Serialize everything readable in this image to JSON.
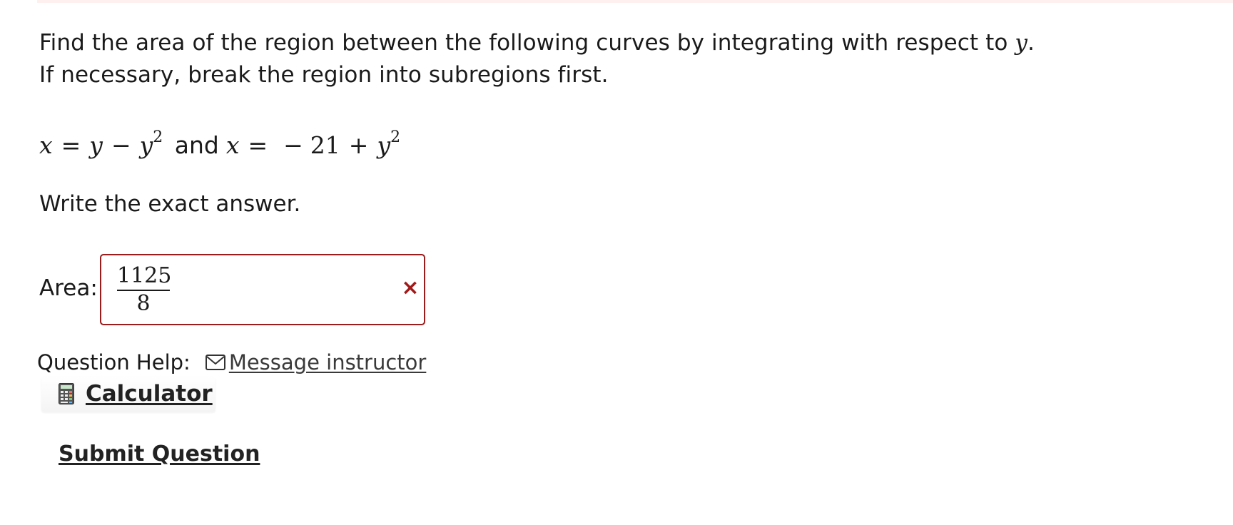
{
  "question": {
    "text_before_var": "Find the area of the region between the following curves by integrating with respect to ",
    "variable": "y",
    "text_after_var": ". If necessary, break the region into subregions first."
  },
  "equation": {
    "lhs1": "x",
    "eq1_y": "y",
    "eq1_minus": "−",
    "eq1_y2": "y",
    "eq1_exp": "2",
    "conjunction": "and",
    "lhs2": "x",
    "eq2_minus": "−",
    "eq2_const": "21",
    "eq2_plus": "+",
    "eq2_y": "y",
    "eq2_exp": "2",
    "equals": "="
  },
  "instruction": "Write the exact answer.",
  "answer": {
    "label": "Area:",
    "numerator": "1125",
    "denominator": "8",
    "status": "incorrect",
    "status_icon": "×",
    "status_color": "#a11a1a"
  },
  "help": {
    "label": "Question Help:",
    "message_link": "Message instructor",
    "calculator": "Calculator"
  },
  "submit": "Submit Question"
}
